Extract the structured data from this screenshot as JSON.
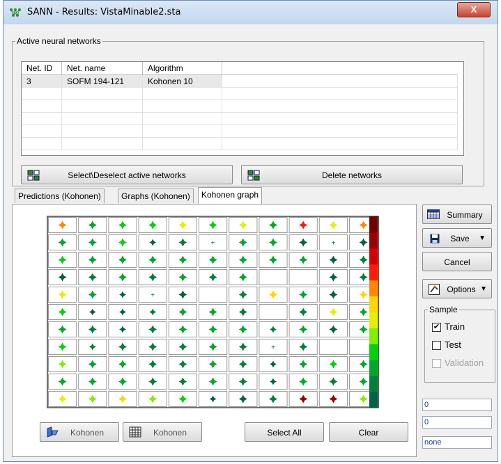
{
  "window": {
    "title": "SANN - Results: VistaMinable2.sta",
    "close_label": "X"
  },
  "active_networks": {
    "legend": "Active neural networks",
    "columns": [
      "Net. ID",
      "Net. name",
      "Algorithm"
    ],
    "rows": [
      {
        "id": "3",
        "name": "SOFM 194-121",
        "algorithm": "Kohonen 10"
      }
    ],
    "select_button": "Select\\Deselect active networks",
    "delete_button": "Delete networks"
  },
  "tabs": [
    {
      "label": "Predictions (Kohonen)",
      "active": false
    },
    {
      "label": "Graphs (Kohonen)",
      "active": false
    },
    {
      "label": "Kohonen graph",
      "active": true
    }
  ],
  "kohonen_graph": {
    "cols": 11,
    "rows": 11,
    "palette": [
      "#006048",
      "#007f3a",
      "#00a82a",
      "#00d20e",
      "#7ef000",
      "#e4f000",
      "#ffd600",
      "#ff8800",
      "#ff1b00",
      "#d40000",
      "#9c0000",
      "#700000"
    ],
    "cells": [
      [
        "7",
        "2",
        "3",
        "3",
        "5",
        "3",
        "5",
        "2",
        "8",
        "5",
        "7"
      ],
      [
        "2",
        "2",
        "3",
        "0s",
        "1",
        "0t",
        "2",
        "2",
        "0",
        "0t",
        "0"
      ],
      [
        "3",
        "2",
        "2",
        "2",
        "2",
        "2",
        "2",
        "2",
        "2",
        "0",
        "1"
      ],
      [
        "0",
        "1",
        "2",
        "1",
        "2",
        "1",
        "2",
        "",
        "",
        "0",
        "1"
      ],
      [
        "5",
        "2",
        "0s",
        "0t",
        "0",
        "",
        "1",
        "6",
        "2",
        "0",
        "6"
      ],
      [
        "3",
        "0s",
        "0s",
        "1s",
        "2",
        "2",
        "1",
        "",
        "1",
        "5",
        "2"
      ],
      [
        "2",
        "1",
        "0s",
        "1",
        "2",
        "2",
        "2",
        "1s",
        "2",
        "0",
        "2"
      ],
      [
        "3",
        "1s",
        "1",
        "1",
        "1",
        "2",
        "1",
        "0t",
        "1",
        "",
        ""
      ],
      [
        "4",
        "2",
        "2",
        "1",
        "1",
        "2",
        "1",
        "0s",
        "2",
        "3",
        "2"
      ],
      [
        "2",
        "2",
        "2",
        "1",
        "1",
        "2",
        "1",
        "0s",
        "2",
        "1",
        "2"
      ],
      [
        "5",
        "4",
        "6",
        "4",
        "3",
        "0s",
        "0",
        "1",
        "10",
        "10",
        "4"
      ]
    ]
  },
  "bottom_buttons": {
    "kohonen1": "Kohonen",
    "kohonen2": "Kohonen",
    "select_all": "Select All",
    "clear": "Clear"
  },
  "side": {
    "summary": "Summary",
    "save": "Save",
    "cancel": "Cancel",
    "options": "Options",
    "sample_legend": "Sample",
    "train": "Train",
    "test": "Test",
    "validation": "Validation",
    "train_checked": true,
    "test_checked": false,
    "status1": "0",
    "status2": "0",
    "status3": "none"
  }
}
